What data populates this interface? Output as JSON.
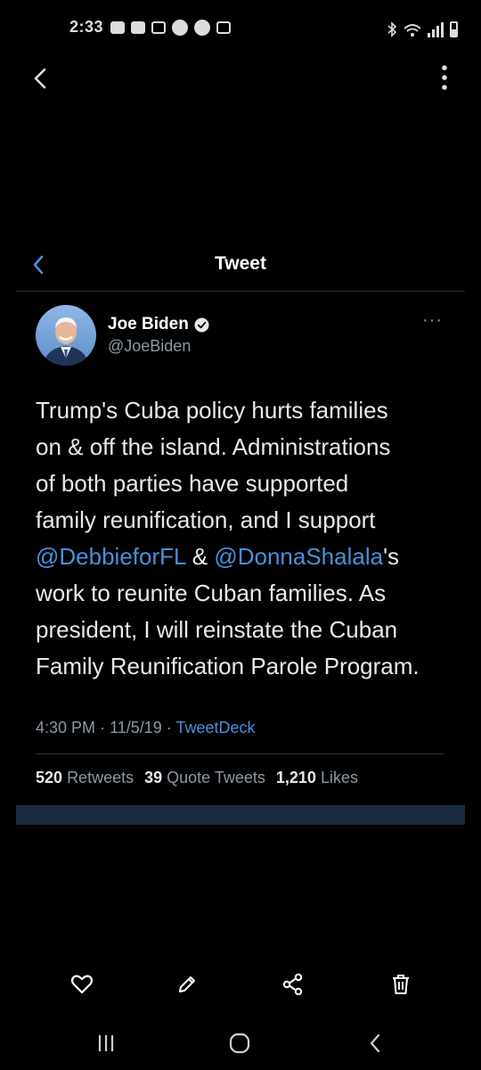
{
  "status": {
    "time": "2:33"
  },
  "tweet_header": {
    "title": "Tweet"
  },
  "author": {
    "name": "Joe Biden",
    "handle": "@JoeBiden"
  },
  "tweet": {
    "line1": "Trump's Cuba policy hurts families",
    "line2": "on & off the island. Administrations",
    "line3": "of both parties have supported",
    "line4": "family reunification, and I support",
    "mention1": "@DebbieforFL",
    "amp": " & ",
    "mention2": "@DonnaShalala",
    "poss": "'s",
    "line6": "work to reunite Cuban families. As",
    "line7": "president, I will reinstate the Cuban",
    "line8": "Family Reunification Parole Program."
  },
  "meta": {
    "time": "4:30 PM",
    "date": "11/5/19",
    "source": "TweetDeck"
  },
  "stats": {
    "retweets_count": "520",
    "retweets_label": "Retweets",
    "quotes_count": "39",
    "quotes_label": "Quote Tweets",
    "likes_count": "1,210",
    "likes_label": "Likes"
  },
  "colors": {
    "background": "#000000",
    "link": "#4a90d9",
    "secondary": "#8b98a5"
  },
  "icons": {
    "actions": [
      "heart-icon",
      "pencil-icon",
      "share-icon",
      "trash-icon"
    ],
    "nav": [
      "recents-icon",
      "home-icon",
      "back-icon"
    ]
  }
}
